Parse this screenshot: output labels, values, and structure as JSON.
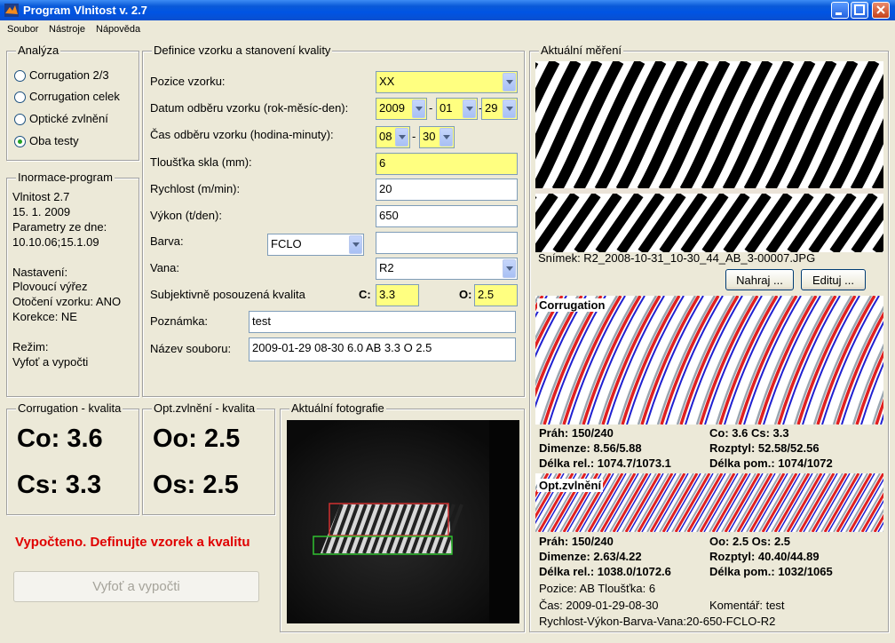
{
  "window": {
    "title": "Program Vlnitost v. 2.7"
  },
  "menu": [
    "Soubor",
    "Nástroje",
    "Nápověda"
  ],
  "analysis": {
    "legend": "Analýza",
    "options": [
      {
        "label": "Corrugation 2/3",
        "checked": false
      },
      {
        "label": "Corrugation celek",
        "checked": false
      },
      {
        "label": "Optické zvlnění",
        "checked": false
      },
      {
        "label": "Oba testy",
        "checked": true
      }
    ]
  },
  "info": {
    "legend": "Inormace-program",
    "lines": [
      "Vlnitost 2.7",
      "15. 1. 2009",
      "Parametry ze dne:",
      "10.10.06;15.1.09",
      "",
      "Nastavení:",
      "Plovoucí výřez",
      "Otočení vzorku: ANO",
      "Korekce: NE",
      "",
      "Režim:",
      "Vyfoť a vypočti"
    ]
  },
  "definition": {
    "legend": "Definice vzorku a stanovení kvality",
    "position_label": "Pozice vzorku:",
    "position_value": "XX",
    "date_label": "Datum odběru vzorku (rok-měsíc-den):",
    "year": "2009",
    "month": "01",
    "day": "29",
    "time_label": "Čas odběru vzorku (hodina-minuty):",
    "hour": "08",
    "minute": "30",
    "thickness_label": "Tloušťka skla (mm):",
    "thickness": "6",
    "speed_label": "Rychlost (m/min):",
    "speed": "20",
    "output_label": "Výkon (t/den):",
    "output": "650",
    "color_label": "Barva:",
    "color": "FCLO",
    "color_extra": "",
    "tank_label": "Vana:",
    "tank": "R2",
    "quality_label": "Subjektivně posouzená kvalita",
    "c_label": "C:",
    "c_value": "3.3",
    "o_label": "O:",
    "o_value": "2.5",
    "note_label": "Poznámka:",
    "note": "test",
    "file_label": "Název souboru:",
    "file": "2009-01-29 08-30 6.0 AB 3.3 O 2.5",
    "dash": "-"
  },
  "corr_quality": {
    "legend": "Corrugation - kvalita",
    "co": "Co: 3.6",
    "cs": "Cs: 3.3"
  },
  "opt_quality": {
    "legend": "Opt.zvlnění - kvalita",
    "oo": "Oo: 2.5",
    "os": "Os: 2.5"
  },
  "photo": {
    "legend": "Aktuální fotografie"
  },
  "status": "Vypočteno. Definujte vzorek a kvalitu",
  "action_button": "Vyfoť a vypočti",
  "measurement": {
    "legend": "Aktuální měření",
    "snapshot": "Snímek: R2_2008-10-31_10-30_44_AB_3-00007.JPG",
    "load_button": "Nahraj ...",
    "edit_button": "Edituj ...",
    "corr_title": "Corrugation",
    "corr_stats": {
      "prah": "Práh: 150/240",
      "dimenze": "Dimenze: 8.56/5.88",
      "delka_rel": "Délka rel.: 1074.7/1073.1",
      "co_cs": "Co: 3.6 Cs: 3.3",
      "rozptyl": "Rozptyl: 52.58/52.56",
      "delka_pom": "Délka pom.: 1074/1072"
    },
    "opt_title": "Opt.zvlnění",
    "opt_stats": {
      "prah": "Práh: 150/240",
      "dimenze": "Dimenze: 2.63/4.22",
      "delka_rel": "Délka rel.: 1038.0/1072.6",
      "oo_os": "Oo: 2.5 Os: 2.5",
      "rozptyl": "Rozptyl: 40.40/44.89",
      "delka_pom": "Délka pom.: 1032/1065"
    },
    "footer": {
      "pozice": "Pozice: AB Tloušťka: 6",
      "cas": "Čas: 2009-01-29-08-30",
      "komentar": "Komentář: test",
      "rychlost": "Rychlost-Výkon-Barva-Vana:20-650-FCLO-R2"
    }
  }
}
